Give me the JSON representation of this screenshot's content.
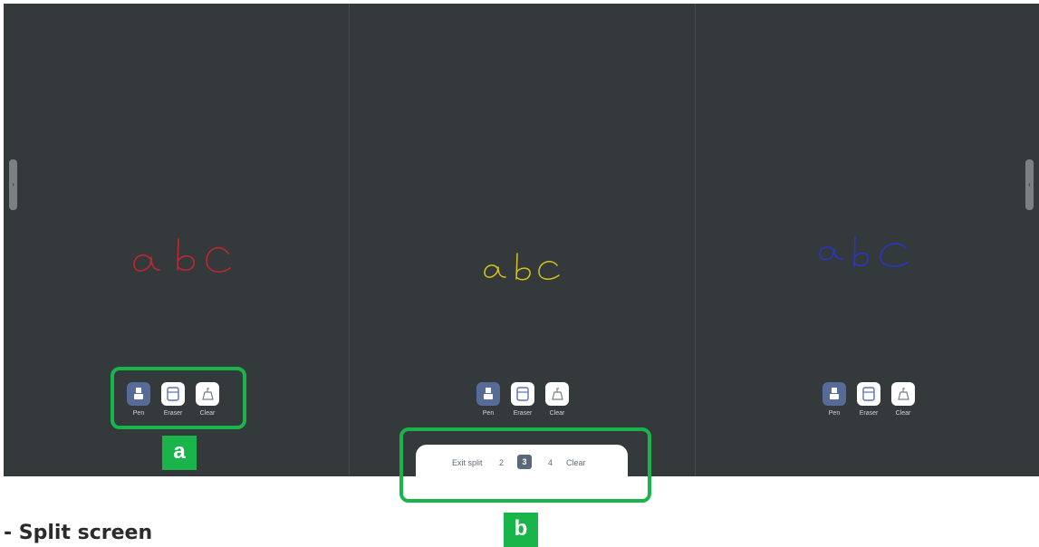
{
  "panes": [
    {
      "id": "left",
      "ink_text": "abc",
      "ink_color": "#c0272d",
      "toolbar": {
        "pen_label": "Pen",
        "eraser_label": "Eraser",
        "clear_label": "Clear",
        "active_tool": "pen"
      }
    },
    {
      "id": "center",
      "ink_text": "abc",
      "ink_color": "#d6c21e",
      "toolbar": {
        "pen_label": "Pen",
        "eraser_label": "Eraser",
        "clear_label": "Clear",
        "active_tool": "pen"
      }
    },
    {
      "id": "right",
      "ink_text": "abc",
      "ink_color": "#2b35c8",
      "toolbar": {
        "pen_label": "Pen",
        "eraser_label": "Eraser",
        "clear_label": "Clear",
        "active_tool": "pen"
      }
    }
  ],
  "split_panel": {
    "exit_label": "Exit split",
    "options": [
      "2",
      "3",
      "4"
    ],
    "selected": "3",
    "clear_label": "Clear"
  },
  "callouts": {
    "a": "a",
    "b": "b"
  },
  "colors": {
    "board": "#343a3b",
    "accent_green": "#1ab54a",
    "active_tool": "#566b95"
  },
  "caption": "- Split screen"
}
